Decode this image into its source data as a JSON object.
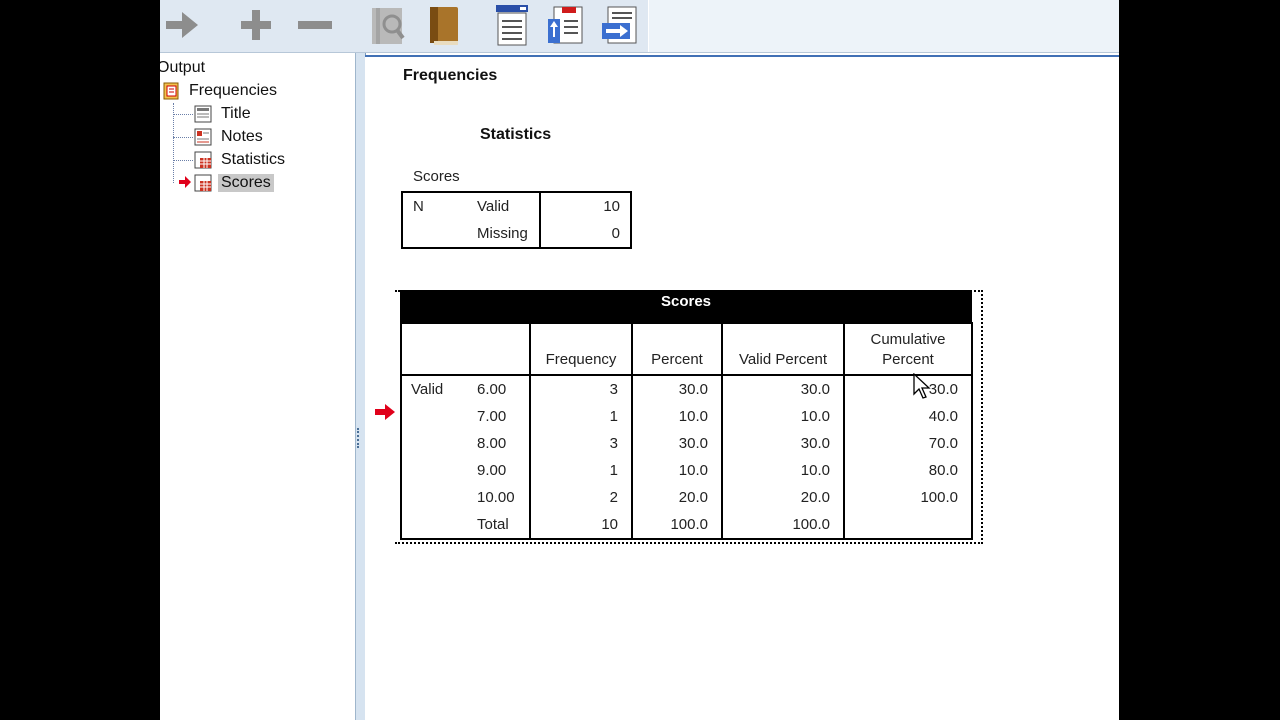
{
  "toolbar": {
    "buttons": [
      {
        "icon": "forward-arrow-icon"
      },
      {
        "icon": "expand-plus-icon"
      },
      {
        "icon": "collapse-minus-icon"
      },
      {
        "icon": "hide-icon"
      },
      {
        "icon": "book-icon"
      },
      {
        "icon": "insert-heading-icon"
      },
      {
        "icon": "insert-title-icon"
      },
      {
        "icon": "insert-text-icon"
      }
    ]
  },
  "outline": {
    "root": "Output",
    "items": [
      {
        "label": "Frequencies",
        "icon": "procedure-book-icon",
        "level": 1
      },
      {
        "label": "Title",
        "icon": "title-page-icon",
        "level": 2
      },
      {
        "label": "Notes",
        "icon": "notes-icon",
        "level": 2
      },
      {
        "label": "Statistics",
        "icon": "table-icon",
        "level": 2
      },
      {
        "label": "Scores",
        "icon": "table-icon",
        "level": 2,
        "selected": true
      }
    ]
  },
  "content": {
    "heading": "Frequencies",
    "statistics": {
      "title": "Statistics",
      "caption": "Scores",
      "rows": [
        {
          "group": "N",
          "label": "Valid",
          "value": "10"
        },
        {
          "group": "",
          "label": "Missing",
          "value": "0"
        }
      ]
    },
    "scores_table": {
      "title": "Scores",
      "headers": [
        "Frequency",
        "Percent",
        "Valid Percent",
        "Cumulative Percent"
      ],
      "group_label": "Valid",
      "rows": [
        {
          "value": "6.00",
          "frequency": "3",
          "percent": "30.0",
          "valid_percent": "30.0",
          "cumulative": "30.0"
        },
        {
          "value": "7.00",
          "frequency": "1",
          "percent": "10.0",
          "valid_percent": "10.0",
          "cumulative": "40.0"
        },
        {
          "value": "8.00",
          "frequency": "3",
          "percent": "30.0",
          "valid_percent": "30.0",
          "cumulative": "70.0"
        },
        {
          "value": "9.00",
          "frequency": "1",
          "percent": "10.0",
          "valid_percent": "10.0",
          "cumulative": "80.0"
        },
        {
          "value": "10.00",
          "frequency": "2",
          "percent": "20.0",
          "valid_percent": "20.0",
          "cumulative": "100.0"
        },
        {
          "value": "Total",
          "frequency": "10",
          "percent": "100.0",
          "valid_percent": "100.0",
          "cumulative": ""
        }
      ]
    }
  },
  "colors": {
    "accent_arrow": "#e0001a",
    "tree_line": "#6a7fa8",
    "splitter_border": "#4170b5"
  }
}
